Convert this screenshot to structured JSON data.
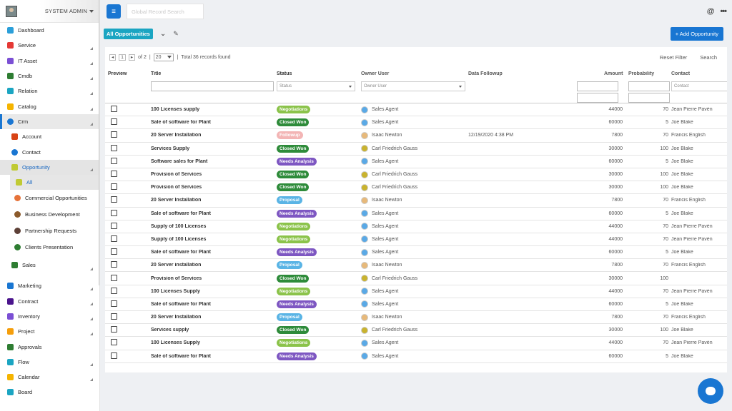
{
  "sidebar": {
    "user": "SYSTEM ADMIN",
    "items": [
      {
        "label": "Dashboard",
        "color": "#2b9fd9",
        "expand": false
      },
      {
        "label": "Service",
        "color": "#e53935",
        "expand": true
      },
      {
        "label": "IT Asset",
        "color": "#7b4fd4",
        "expand": true
      },
      {
        "label": "Cmdb",
        "color": "#2e7d32",
        "expand": true
      },
      {
        "label": "Relation",
        "color": "#1ba5c2",
        "expand": true
      },
      {
        "label": "Catalog",
        "color": "#f5b400",
        "expand": true
      }
    ],
    "crm": {
      "label": "Crm",
      "account": "Account",
      "contact": "Contact",
      "opportunity": "Opportunity",
      "all": "All",
      "views": [
        {
          "label": "Commercial Opportunities",
          "color": "#e6733a"
        },
        {
          "label": "Business Development",
          "color": "#8b5a2b"
        },
        {
          "label": "Partnership Requests",
          "color": "#5d4037"
        },
        {
          "label": "Clients Presentation",
          "color": "#2e7d32"
        }
      ],
      "sales": "Sales"
    },
    "items2": [
      {
        "label": "Marketing",
        "color": "#1976d2",
        "expand": true
      },
      {
        "label": "Contract",
        "color": "#4a148c",
        "expand": true
      },
      {
        "label": "Inventory",
        "color": "#7b4fd4",
        "expand": true
      },
      {
        "label": "Project",
        "color": "#f59e0b",
        "expand": true
      },
      {
        "label": "Approvals",
        "color": "#2e7d32",
        "expand": false
      },
      {
        "label": "Flow",
        "color": "#1ba5c2",
        "expand": true
      },
      {
        "label": "Calendar",
        "color": "#f5b400",
        "expand": true
      },
      {
        "label": "Board",
        "color": "#1ba5c2",
        "expand": false
      }
    ]
  },
  "topbar": {
    "search_placeholder": "Global Record Search"
  },
  "viewbar": {
    "view": "All Opportunities",
    "add": "Add Opportunity"
  },
  "pager": {
    "page": "1",
    "of": "of 2",
    "per_page": "20",
    "total": "Total 36 records found",
    "reset": "Reset Filter",
    "search": "Search"
  },
  "columns": {
    "preview": "Preview",
    "title": "Title",
    "status": "Status",
    "owner": "Owner User",
    "followup": "Data Followup",
    "amount": "Amount",
    "probability": "Probability",
    "contact": "Contact"
  },
  "filters": {
    "status": "Status",
    "owner": "Owner User",
    "contact": "Contact"
  },
  "status_colors": {
    "Negotiations": "#8bc34a",
    "Closed Won": "#2e8b3a",
    "Followup": "#f3b5b5",
    "Needs Analysis": "#7e57c2",
    "Proposal": "#5ab4e5"
  },
  "owner_colors": {
    "Sales Agent": "#5aa9e6",
    "Isaac Newton": "#e7b97a",
    "Carl Friedrich Gauss": "#c9b32e"
  },
  "rows": [
    {
      "title": "100 Licenses supply",
      "status": "Negotiations",
      "owner": "Sales Agent",
      "followup": "",
      "amount": "44000",
      "prob": "70",
      "contact": "Jean Pierre Pavén"
    },
    {
      "title": "Sale of software for Plant",
      "status": "Closed Won",
      "owner": "Sales Agent",
      "followup": "",
      "amount": "60000",
      "prob": "5",
      "contact": "Joe Blake"
    },
    {
      "title": "20 Server Installation",
      "status": "Followup",
      "owner": "Isaac Newton",
      "followup": "12/19/2020 4:38 PM",
      "amount": "7800",
      "prob": "70",
      "contact": "Francis English"
    },
    {
      "title": "Services Supply",
      "status": "Closed Won",
      "owner": "Carl Friedrich Gauss",
      "followup": "",
      "amount": "30000",
      "prob": "100",
      "contact": "Joe Blake"
    },
    {
      "title": "Software sales for Plant",
      "status": "Needs Analysis",
      "owner": "Sales Agent",
      "followup": "",
      "amount": "60000",
      "prob": "5",
      "contact": "Joe Blake"
    },
    {
      "title": "Provision of Services",
      "status": "Closed Won",
      "owner": "Carl Friedrich Gauss",
      "followup": "",
      "amount": "30000",
      "prob": "100",
      "contact": "Joe Blake"
    },
    {
      "title": "Provision of Services",
      "status": "Closed Won",
      "owner": "Carl Friedrich Gauss",
      "followup": "",
      "amount": "30000",
      "prob": "100",
      "contact": "Joe Blake"
    },
    {
      "title": "20 Server Installation",
      "status": "Proposal",
      "owner": "Isaac Newton",
      "followup": "",
      "amount": "7800",
      "prob": "70",
      "contact": "Francis English"
    },
    {
      "title": "Sale of software for Plant",
      "status": "Needs Analysis",
      "owner": "Sales Agent",
      "followup": "",
      "amount": "60000",
      "prob": "5",
      "contact": "Joe Blake"
    },
    {
      "title": "Supply of 100 Licenses",
      "status": "Negotiations",
      "owner": "Sales Agent",
      "followup": "",
      "amount": "44000",
      "prob": "70",
      "contact": "Jean Pierre Pavén"
    },
    {
      "title": "Supply of 100 Licenses",
      "status": "Negotiations",
      "owner": "Sales Agent",
      "followup": "",
      "amount": "44000",
      "prob": "70",
      "contact": "Jean Pierre Pavén"
    },
    {
      "title": "Sale of software for Plant",
      "status": "Needs Analysis",
      "owner": "Sales Agent",
      "followup": "",
      "amount": "60000",
      "prob": "5",
      "contact": "Joe Blake"
    },
    {
      "title": "20 Server installation",
      "status": "Proposal",
      "owner": "Isaac Newton",
      "followup": "",
      "amount": "7800",
      "prob": "70",
      "contact": "Francis English"
    },
    {
      "title": "Provision of Services",
      "status": "Closed Won",
      "owner": "Carl Friedrich Gauss",
      "followup": "",
      "amount": "30000",
      "prob": "100",
      "contact": ""
    },
    {
      "title": "100 Licenses Supply",
      "status": "Negotiations",
      "owner": "Sales Agent",
      "followup": "",
      "amount": "44000",
      "prob": "70",
      "contact": "Jean Pierre Pavén"
    },
    {
      "title": "Sale of software for Plant",
      "status": "Needs Analysis",
      "owner": "Sales Agent",
      "followup": "",
      "amount": "60000",
      "prob": "5",
      "contact": "Joe Blake"
    },
    {
      "title": "20 Server Installation",
      "status": "Proposal",
      "owner": "Isaac Newton",
      "followup": "",
      "amount": "7800",
      "prob": "70",
      "contact": "Francis English"
    },
    {
      "title": "Services supply",
      "status": "Closed Won",
      "owner": "Carl Friedrich Gauss",
      "followup": "",
      "amount": "30000",
      "prob": "100",
      "contact": "Joe Blake"
    },
    {
      "title": "100 Licenses Supply",
      "status": "Negotiations",
      "owner": "Sales Agent",
      "followup": "",
      "amount": "44000",
      "prob": "70",
      "contact": "Jean Pierre Pavén"
    },
    {
      "title": "Sale of software for Plant",
      "status": "Needs Analysis",
      "owner": "Sales Agent",
      "followup": "",
      "amount": "60000",
      "prob": "5",
      "contact": "Joe Blake"
    }
  ]
}
